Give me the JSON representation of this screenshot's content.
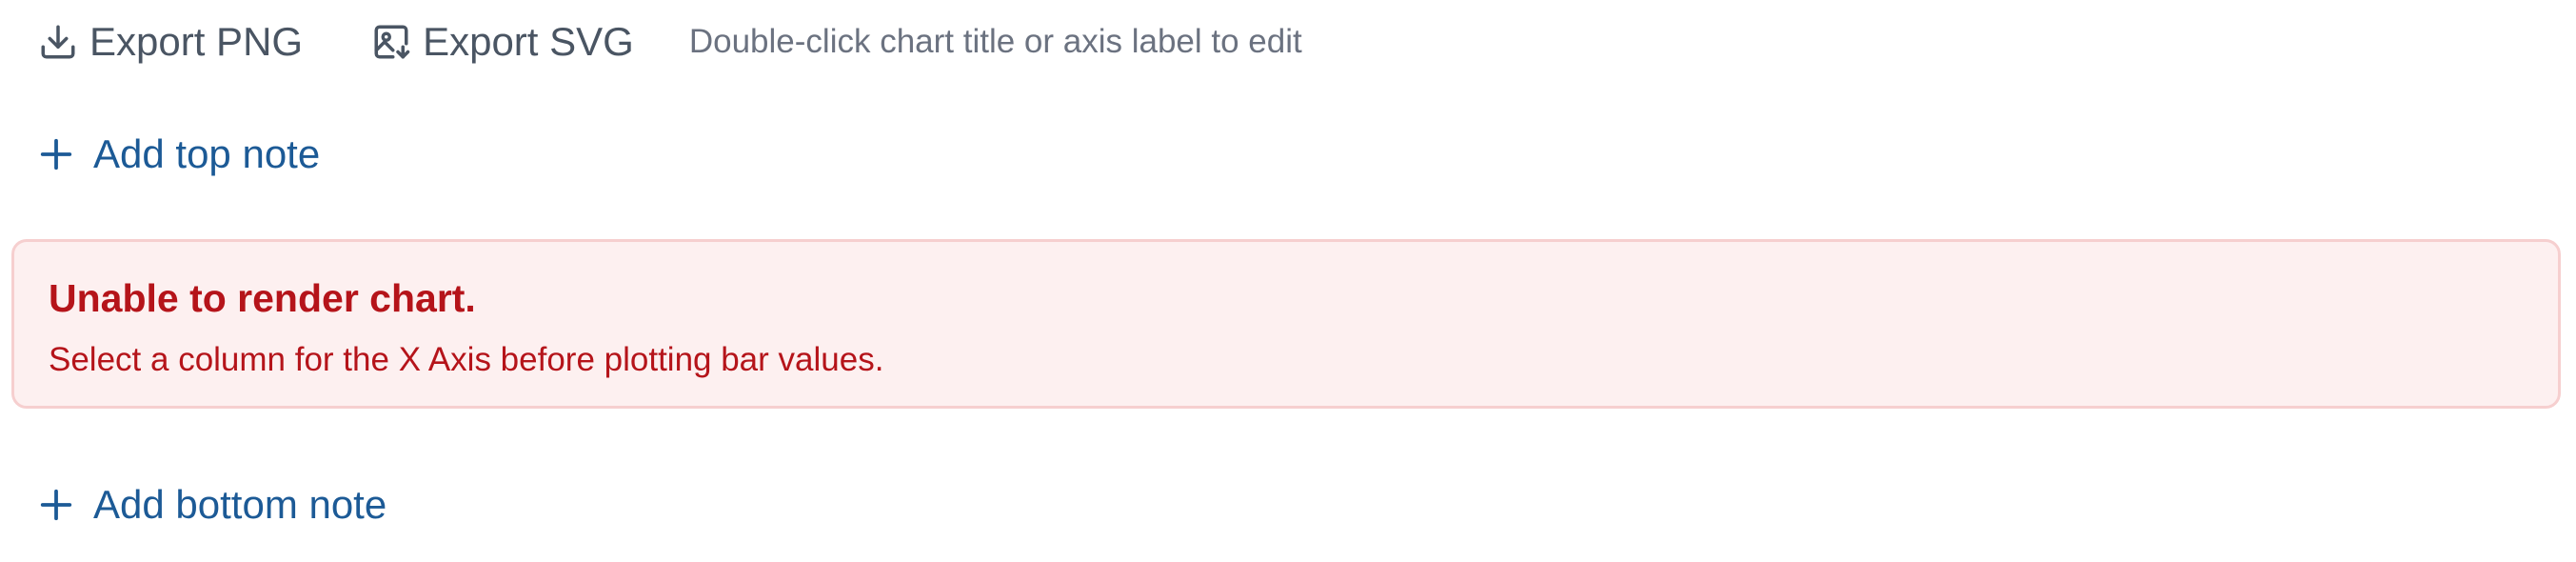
{
  "toolbar": {
    "export_png_label": "Export PNG",
    "export_png_icon": "download-icon",
    "export_svg_label": "Export SVG",
    "export_svg_icon": "image-export-icon",
    "hint": "Double-click chart title or axis label to edit"
  },
  "notes": {
    "add_top_label": "Add top note",
    "add_bottom_label": "Add bottom note",
    "icon": "plus-icon"
  },
  "error": {
    "title": "Unable to render chart.",
    "message": "Select a column for the X Axis before plotting bar values."
  },
  "colors": {
    "link": "#1c5a96",
    "toolbar_text": "#4a5563",
    "hint_text": "#6b7280",
    "error_text": "#b5141a",
    "error_bg": "#fdf0f0",
    "error_border": "#f6cfcf"
  }
}
